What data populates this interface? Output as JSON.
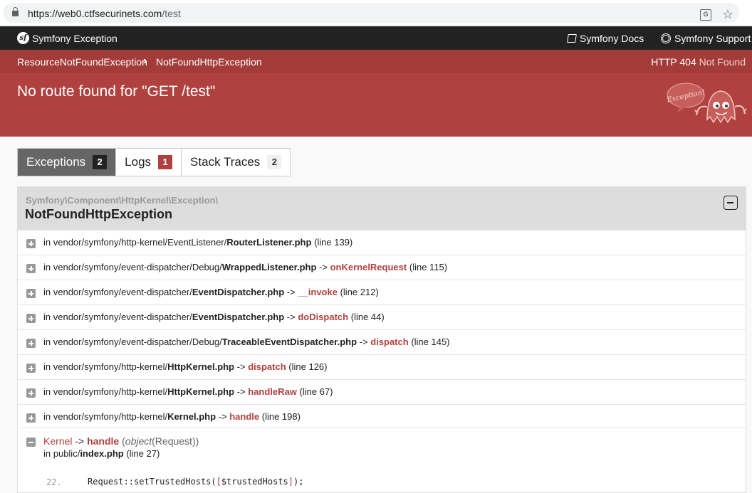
{
  "browser": {
    "url_host": "https://web0.ctfsecurinets.com",
    "url_path": "/test",
    "translate_icon": "translate-icon",
    "star_icon": "star-icon"
  },
  "header": {
    "logo_glyph": "sf",
    "title": "Symfony Exception",
    "docs_label": "Symfony Docs",
    "support_label": "Symfony Support"
  },
  "summary": {
    "breadcrumb": [
      "ResourceNotFoundException",
      "NotFoundHttpException"
    ],
    "breadcrumb_sep": "›",
    "status_code": "HTTP 404",
    "status_text": "Not Found",
    "message": "No route found for \"GET /test\"",
    "ghost_text": "Exception!"
  },
  "tabs": [
    {
      "label": "Exceptions",
      "count": "2"
    },
    {
      "label": "Logs",
      "count": "1"
    },
    {
      "label": "Stack Traces",
      "count": "2"
    }
  ],
  "trace": {
    "namespace": "Symfony\\Component\\HttpKernel\\Exception\\",
    "class": "NotFoundHttpException",
    "rows": [
      {
        "prefix": "in vendor/symfony/http-kernel/EventListener/",
        "file": "RouterListener.php",
        "arrow": "",
        "fn": "",
        "line": "(line 139)"
      },
      {
        "prefix": "in vendor/symfony/event-dispatcher/Debug/",
        "file": "WrappedListener.php",
        "arrow": "->",
        "fn": "onKernelRequest",
        "line": "(line 115)"
      },
      {
        "prefix": "in vendor/symfony/event-dispatcher/",
        "file": "EventDispatcher.php",
        "arrow": "->",
        "fn": "__invoke",
        "line": "(line 212)"
      },
      {
        "prefix": "in vendor/symfony/event-dispatcher/",
        "file": "EventDispatcher.php",
        "arrow": "->",
        "fn": "doDispatch",
        "line": "(line 44)"
      },
      {
        "prefix": "in vendor/symfony/event-dispatcher/Debug/",
        "file": "TraceableEventDispatcher.php",
        "arrow": "->",
        "fn": "dispatch",
        "line": "(line 145)"
      },
      {
        "prefix": "in vendor/symfony/http-kernel/",
        "file": "HttpKernel.php",
        "arrow": "->",
        "fn": "dispatch",
        "line": "(line 126)"
      },
      {
        "prefix": "in vendor/symfony/http-kernel/",
        "file": "HttpKernel.php",
        "arrow": "->",
        "fn": "handleRaw",
        "line": "(line 67)"
      },
      {
        "prefix": "in vendor/symfony/http-kernel/",
        "file": "Kernel.php",
        "arrow": "->",
        "fn": "handle",
        "line": "(line 198)"
      }
    ],
    "open": {
      "cls": "Kernel",
      "arrow": "->",
      "fn": "handle",
      "args_open": "(",
      "args_type": "object",
      "args_rest": "(Request))",
      "loc_prefix": "in public/",
      "loc_file": "index.php",
      "loc_line": "(line 27)",
      "code_num": "22.",
      "code_a": "Request::setTrustedHosts(",
      "code_b": "[",
      "code_c": "$trustedHosts",
      "code_d": "]",
      "code_e": ");"
    }
  }
}
